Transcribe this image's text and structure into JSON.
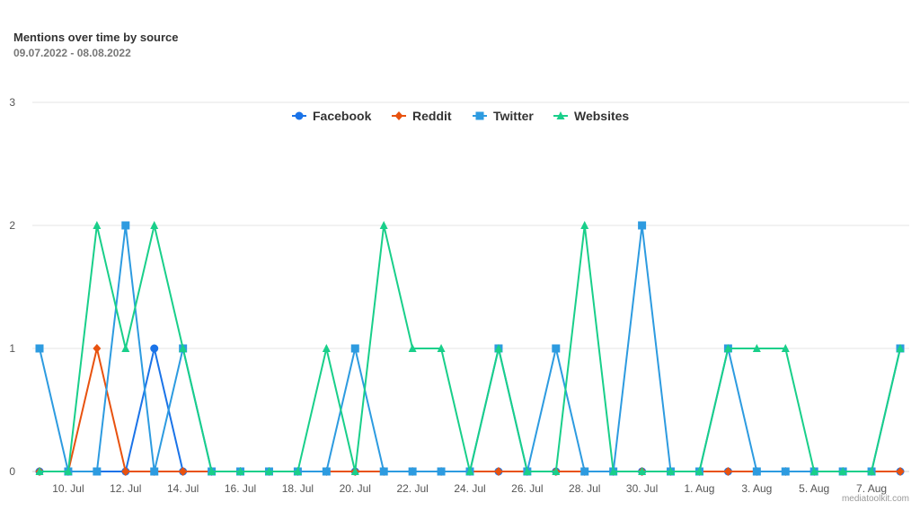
{
  "header": {
    "title": "Mentions over time by source",
    "subtitle": "09.07.2022 - 08.08.2022"
  },
  "credit": "mediatoolkit.com",
  "chart_data": {
    "type": "line",
    "title": "Mentions over time by source",
    "subtitle": "09.07.2022 - 08.08.2022",
    "xlabel": "",
    "ylabel": "",
    "x": [
      "9. Jul",
      "10. Jul",
      "11. Jul",
      "12. Jul",
      "13. Jul",
      "14. Jul",
      "15. Jul",
      "16. Jul",
      "17. Jul",
      "18. Jul",
      "19. Jul",
      "20. Jul",
      "21. Jul",
      "22. Jul",
      "23. Jul",
      "24. Jul",
      "25. Jul",
      "26. Jul",
      "27. Jul",
      "28. Jul",
      "29. Jul",
      "30. Jul",
      "31. Jul",
      "1. Aug",
      "2. Aug",
      "3. Aug",
      "4. Aug",
      "5. Aug",
      "6. Aug",
      "7. Aug",
      "8. Aug"
    ],
    "x_tick_labels": [
      "10. Jul",
      "12. Jul",
      "14. Jul",
      "16. Jul",
      "18. Jul",
      "20. Jul",
      "22. Jul",
      "24. Jul",
      "26. Jul",
      "28. Jul",
      "30. Jul",
      "1. Aug",
      "3. Aug",
      "5. Aug",
      "7. Aug"
    ],
    "ylim": [
      0,
      3
    ],
    "y_ticks": [
      0,
      1,
      2,
      3
    ],
    "grid": true,
    "legend_position": "top-center",
    "series": [
      {
        "name": "Facebook",
        "color": "#1a73e8",
        "marker": "circle",
        "values": [
          0,
          0,
          0,
          0,
          1,
          0,
          0,
          0,
          0,
          0,
          0,
          0,
          0,
          0,
          0,
          0,
          0,
          0,
          0,
          0,
          0,
          0,
          0,
          0,
          0,
          0,
          0,
          0,
          0,
          0,
          0
        ]
      },
      {
        "name": "Reddit",
        "color": "#e8520f",
        "marker": "diamond",
        "values": [
          0,
          0,
          1,
          0,
          0,
          0,
          0,
          0,
          0,
          0,
          0,
          0,
          0,
          0,
          0,
          0,
          0,
          0,
          0,
          0,
          0,
          0,
          0,
          0,
          0,
          0,
          0,
          0,
          0,
          0,
          0
        ]
      },
      {
        "name": "Twitter",
        "color": "#2d9be0",
        "marker": "square",
        "values": [
          1,
          0,
          0,
          2,
          0,
          1,
          0,
          0,
          0,
          0,
          0,
          1,
          0,
          0,
          0,
          0,
          1,
          0,
          1,
          0,
          0,
          2,
          0,
          0,
          1,
          0,
          0,
          0,
          0,
          0,
          1
        ]
      },
      {
        "name": "Websites",
        "color": "#19cf8a",
        "marker": "triangle",
        "values": [
          0,
          0,
          2,
          1,
          2,
          1,
          0,
          0,
          0,
          0,
          1,
          0,
          2,
          1,
          1,
          0,
          1,
          0,
          0,
          2,
          0,
          0,
          0,
          0,
          1,
          1,
          1,
          0,
          0,
          0,
          1
        ]
      }
    ]
  }
}
